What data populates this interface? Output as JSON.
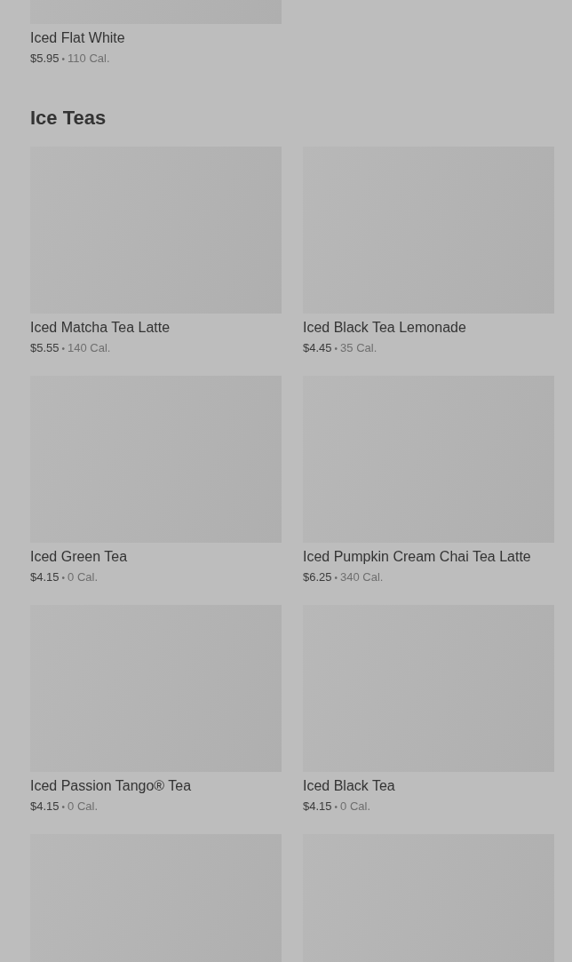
{
  "previous_items": [
    {
      "name": "Iced Flat White",
      "price": "$5.95",
      "separator": "•",
      "calories": "110 Cal."
    }
  ],
  "section": {
    "title": "Ice Teas",
    "items": [
      {
        "kind": "product",
        "name": "Iced Matcha Tea Latte",
        "price": "$5.55",
        "separator": "•",
        "calories": "140 Cal."
      },
      {
        "kind": "product",
        "name": "Iced Black Tea Lemonade",
        "price": "$4.45",
        "separator": "•",
        "calories": "35 Cal."
      },
      {
        "kind": "product",
        "name": "Iced Green Tea",
        "price": "$4.15",
        "separator": "•",
        "calories": "0 Cal."
      },
      {
        "kind": "product",
        "name": "Iced Pumpkin Cream Chai Tea Latte",
        "price": "$6.25",
        "separator": "•",
        "calories": "340 Cal."
      },
      {
        "kind": "product",
        "name": "Iced Passion Tango® Tea",
        "price": "$4.15",
        "separator": "•",
        "calories": "0 Cal."
      },
      {
        "kind": "product",
        "name": "Iced Black Tea",
        "price": "$4.15",
        "separator": "•",
        "calories": "0 Cal."
      },
      {
        "kind": "image-only"
      },
      {
        "kind": "image-only"
      }
    ]
  }
}
